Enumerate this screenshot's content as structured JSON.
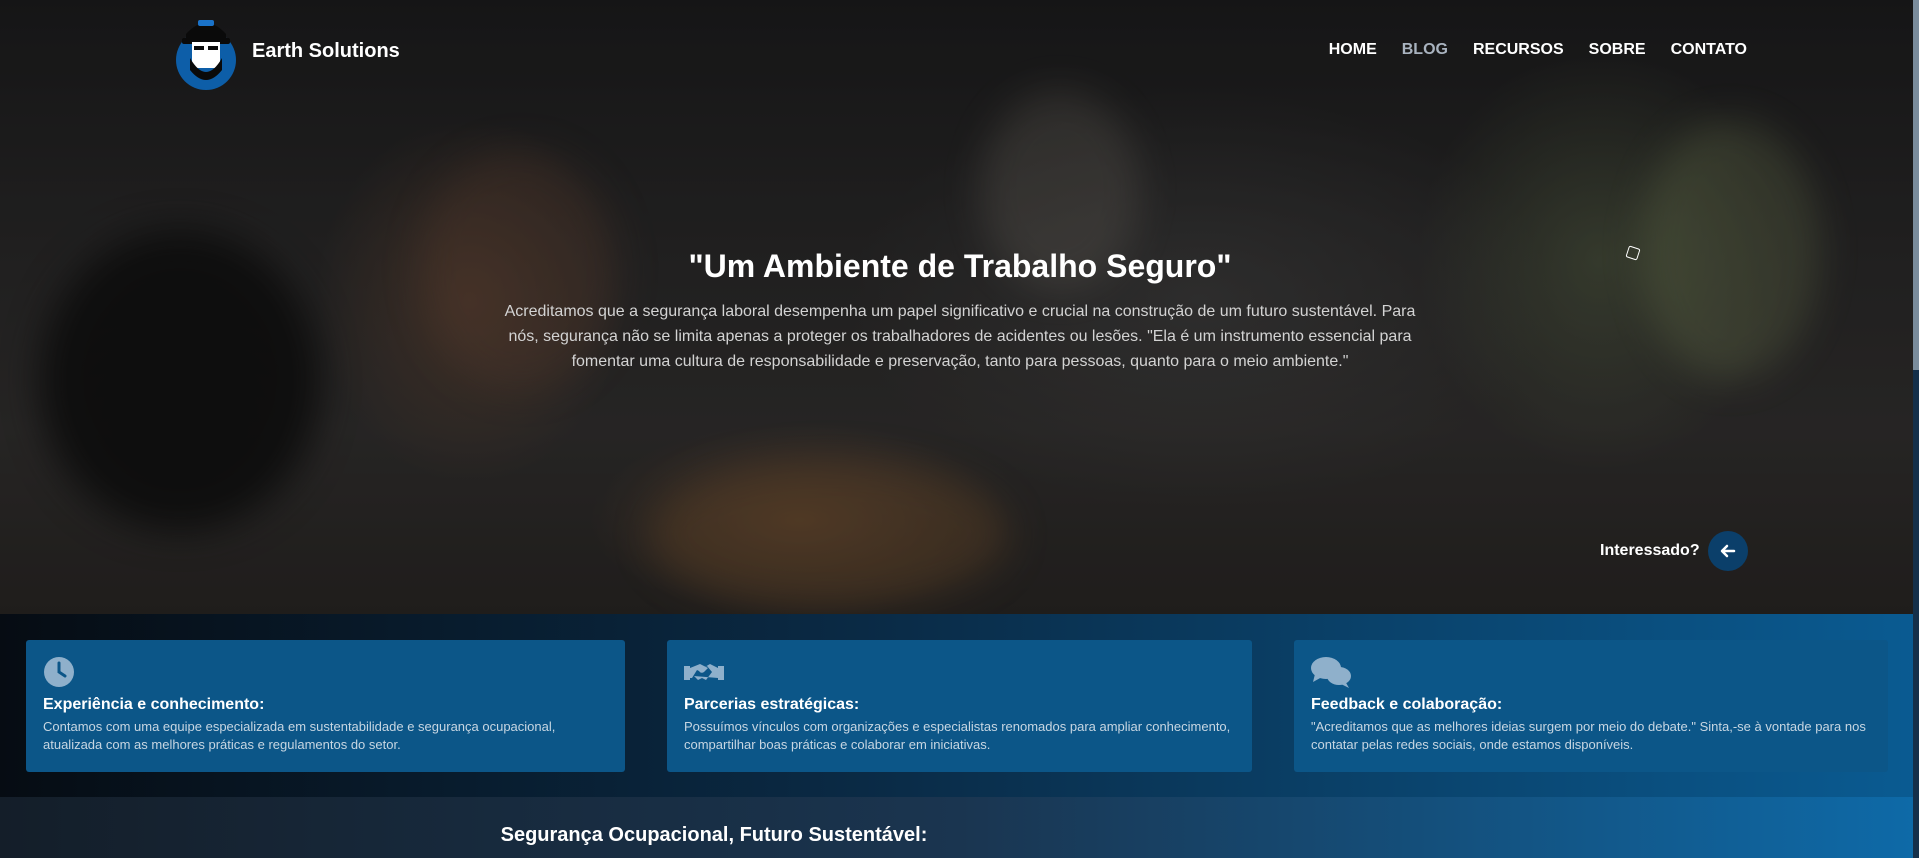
{
  "brand": {
    "name": "Earth Solutions"
  },
  "nav": {
    "items": [
      {
        "label": "HOME",
        "active": false
      },
      {
        "label": "BLOG",
        "active": true
      },
      {
        "label": "RECURSOS",
        "active": false
      },
      {
        "label": "SOBRE",
        "active": false
      },
      {
        "label": "CONTATO",
        "active": false
      }
    ]
  },
  "hero": {
    "title": "\"Um Ambiente de Trabalho Seguro\"",
    "text": "Acreditamos que a segurança laboral desempenha um papel significativo e crucial na construção de um futuro sustentável. Para nós, segurança não se limita apenas a proteger os trabalhadores de acidentes ou lesões. \"Ela é um instrumento essencial para fomentar uma cultura de responsabilidade e preservação, tanto para pessoas, quanto para o meio ambiente.\"",
    "cta_label": "Interessado?",
    "cta_icon": "arrow-left-icon"
  },
  "features": [
    {
      "icon": "clock-icon",
      "title": "Experiência e conhecimento:",
      "text": "Contamos com uma equipe especializada em sustentabilidade e segurança ocupacional, atualizada com as melhores práticas e regulamentos do setor."
    },
    {
      "icon": "handshake-icon",
      "title": "Parcerias estratégicas:",
      "text": "Possuímos vínculos com organizações e especialistas renomados para ampliar conhecimento, compartilhar boas práticas e colaborar em iniciativas."
    },
    {
      "icon": "comments-icon",
      "title": "Feedback e colaboração:",
      "text": "\"Acreditamos que as melhores ideias surgem por meio do debate.\" Sinta,-se à vontade para nos contatar pelas redes sociais, onde estamos disponíveis."
    }
  ],
  "section": {
    "title": "Segurança Ocupacional, Futuro Sustentável:"
  },
  "colors": {
    "accent": "#0b3f6a",
    "card": "#0c5688",
    "nav_active": "#a9b3bf"
  }
}
